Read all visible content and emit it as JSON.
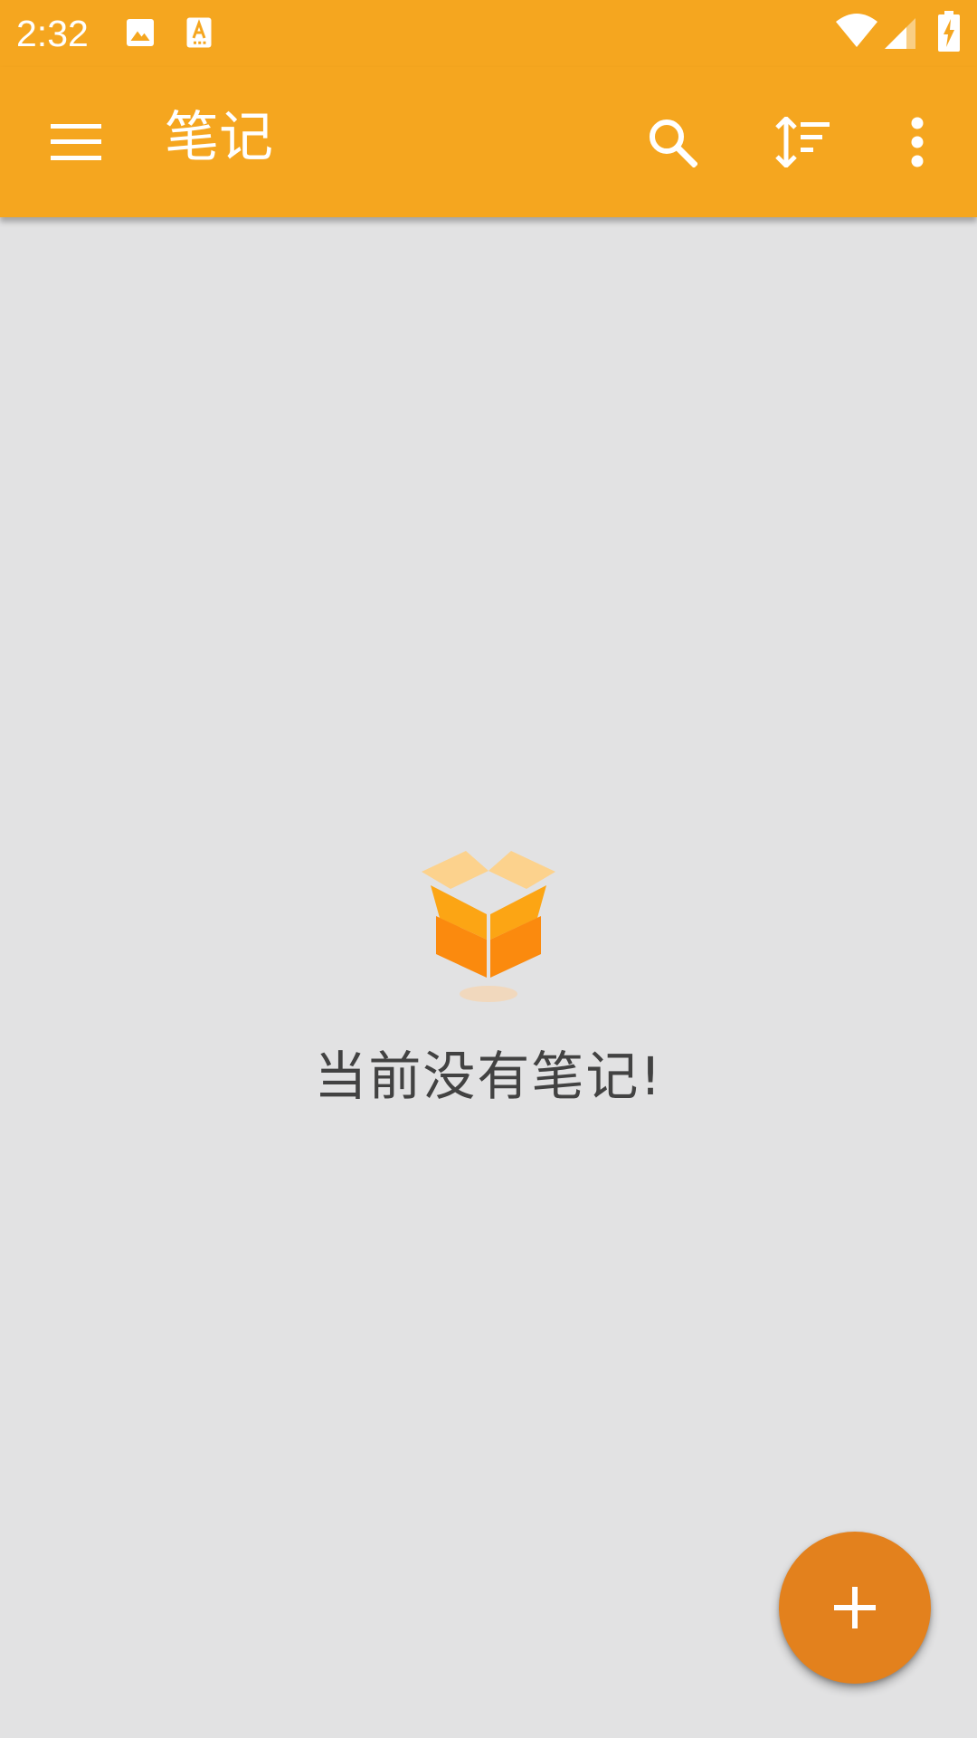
{
  "colors": {
    "primary": "#f5a61f",
    "background": "#e2e2e3",
    "fab": "#e3811d",
    "empty_text": "#424242"
  },
  "status_bar": {
    "time": "2:32",
    "icons": [
      "image-notification-icon",
      "text-recognition-notification-icon",
      "wifi-icon",
      "cell-signal-icon",
      "battery-charging-icon"
    ]
  },
  "app_bar": {
    "title": "笔记",
    "icons": [
      "menu-icon",
      "search-icon",
      "sort-icon",
      "more-vert-icon"
    ]
  },
  "empty_state": {
    "icon": "open-box-icon",
    "message": "当前没有笔记!"
  },
  "fab": {
    "icon": "plus-icon"
  }
}
